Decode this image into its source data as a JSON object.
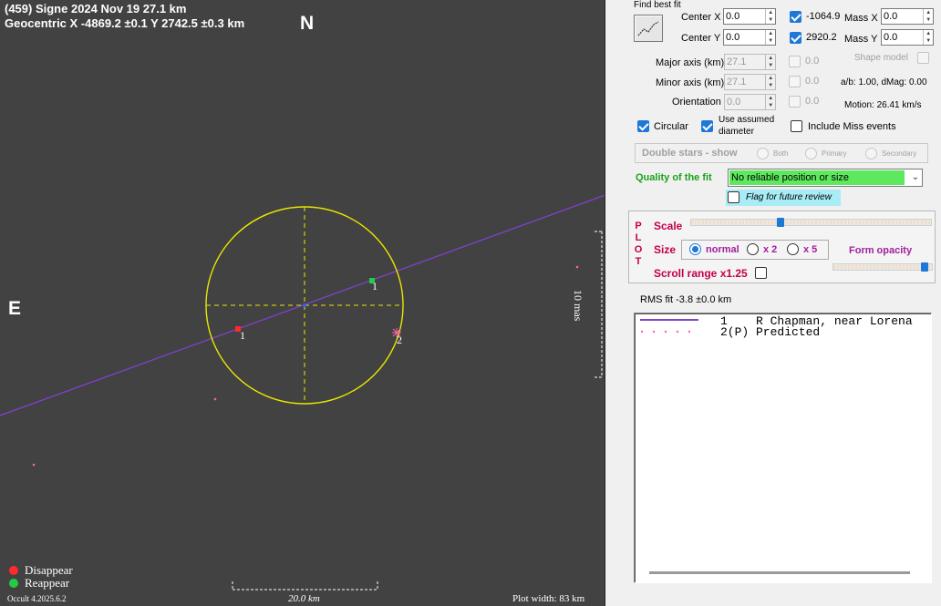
{
  "plot": {
    "header_line1": "(459) Signe  2024 Nov 19   27.1 km",
    "header_line2": "Geocentric  X  -4869.2 ±0.1  Y 2742.5 ±0.3 km",
    "north_label": "N",
    "east_label": "E",
    "chord_labels": [
      {
        "text": "1"
      },
      {
        "text": "1"
      },
      {
        "text": "2"
      }
    ],
    "scale_label": "10 mas",
    "legend": [
      {
        "label": "Disappear",
        "color": "#ff2a2a"
      },
      {
        "label": "Reappear",
        "color": "#22cc44"
      }
    ],
    "version": "Occult 4.2025.6.2",
    "scale_bar_label": "20.0 km",
    "plot_width": "Plot width: 83 km",
    "colors": {
      "background": "#424242",
      "ellipse": "#e8e800",
      "chord": "#8040d0",
      "predicted": "#ff60b0"
    }
  },
  "panel": {
    "find_best_fit": "Find best fit",
    "center_x": {
      "label": "Center X",
      "value": "0.0"
    },
    "center_y": {
      "label": "Center Y",
      "value": "0.0"
    },
    "geo_x": {
      "value": "-1064.9",
      "checked": true
    },
    "geo_y": {
      "value": "2920.2",
      "checked": true
    },
    "mass_x": {
      "label": "Mass X",
      "value": "0.0"
    },
    "mass_y": {
      "label": "Mass Y",
      "value": "0.0"
    },
    "major_axis": {
      "label": "Major axis (km)",
      "value": "27.1",
      "aux": "0.0"
    },
    "minor_axis": {
      "label": "Minor axis (km)",
      "value": "27.1",
      "aux": "0.0"
    },
    "orientation": {
      "label": "Orientation",
      "value": "0.0",
      "aux": "0.0"
    },
    "shape_model": "Shape model",
    "ab_ratio": "a/b: 1.00, dMag: 0.00",
    "motion": "Motion: 26.41 km/s",
    "circular": "Circular",
    "use_assumed_1": "Use assumed",
    "use_assumed_2": "diameter",
    "include_miss": "Include Miss events",
    "double_stars": "Double stars - show",
    "ds_options": [
      "Both",
      "Primary",
      "Secondary"
    ],
    "quality_label": "Quality of the fit",
    "quality_value": "No reliable position or size",
    "flag_review": "Flag for future review",
    "plot_letters": [
      "P",
      "L",
      "O",
      "T"
    ],
    "scale": "Scale",
    "size": "Size",
    "size_options": [
      "normal",
      "x 2",
      "x 5"
    ],
    "form_opacity": "Form opacity",
    "scroll_range": "Scroll range x1.25",
    "rms_fit": "RMS fit -3.8 ±0.0 km",
    "output_lines": [
      "1    R Chapman, near Lorena",
      "2(P) Predicted"
    ]
  }
}
